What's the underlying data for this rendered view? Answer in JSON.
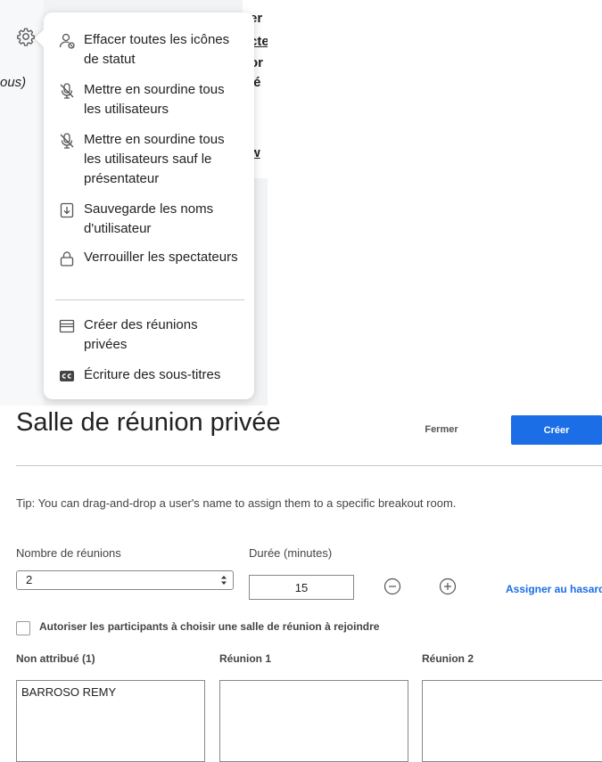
{
  "menu": {
    "items": [
      {
        "label": "Effacer toutes les icônes de statut",
        "icon": "clear-status-icon"
      },
      {
        "label": "Mettre en sourdine tous les utilisateurs",
        "icon": "mute-mic-icon"
      },
      {
        "label": "Mettre en sourdine tous les utilisateurs sauf le présentateur",
        "icon": "mute-mic-icon"
      },
      {
        "label": "Sauvegarde les noms d'utilisateur",
        "icon": "save-file-icon"
      },
      {
        "label": "Verrouiller les spectateurs",
        "icon": "lock-icon"
      },
      {
        "label": "Créer des réunions privées",
        "icon": "breakout-rooms-icon"
      },
      {
        "label": "Écriture des sous-titres",
        "icon": "closed-captions-icon"
      }
    ]
  },
  "background": {
    "side_text": "ous)",
    "fragments": [
      "er",
      "cte",
      "or",
      "ié",
      "w"
    ]
  },
  "dialog": {
    "title": "Salle de réunion privée",
    "close_label": "Fermer",
    "create_label": "Créer",
    "tip": "Tip: You can drag-and-drop a user's name to assign them to a specific breakout room.",
    "count_label": "Nombre de réunions",
    "count_value": "2",
    "duration_label": "Durée (minutes)",
    "duration_value": "15",
    "random_label": "Assigner au hasard",
    "allow_choice_label": "Autoriser les participants à choisir une salle de réunion à rejoindre",
    "allow_choice_checked": false,
    "columns": [
      {
        "header": "Non attribué (1)",
        "users": [
          "BARROSO REMY"
        ]
      },
      {
        "header": "Réunion 1",
        "users": []
      },
      {
        "header": "Réunion 2",
        "users": []
      }
    ]
  },
  "colors": {
    "accent": "#1b6ee5",
    "menu_bg": "#ffffff",
    "pane_bg": "#f1f3f5"
  }
}
